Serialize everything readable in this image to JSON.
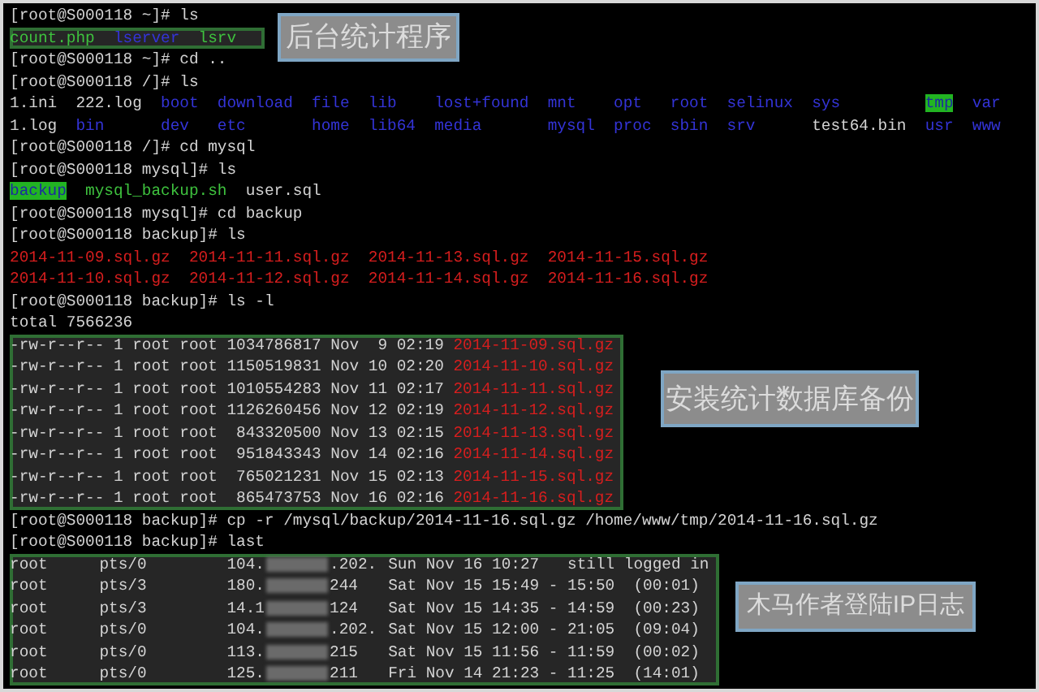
{
  "terminal": {
    "blocks": [
      {
        "kind": "prompt",
        "text": "[root@S000118 ~]# ls"
      },
      {
        "kind": "listing",
        "highlighted": true,
        "rows": [
          [
            {
              "name": "count.php",
              "kind": "exec"
            },
            {
              "name": "lserver",
              "kind": "dir"
            },
            {
              "name": "lsrv",
              "kind": "exec"
            }
          ]
        ]
      },
      {
        "kind": "prompt",
        "text": "[root@S000118 ~]# cd .."
      },
      {
        "kind": "prompt",
        "text": "[root@S000118 /]# ls"
      },
      {
        "kind": "listing",
        "highlighted": false,
        "rows": [
          [
            {
              "name": "1.ini",
              "kind": "file"
            },
            {
              "name": "222.log",
              "kind": "file"
            },
            {
              "name": "boot",
              "kind": "dir"
            },
            {
              "name": "download",
              "kind": "dir"
            },
            {
              "name": "file",
              "kind": "dir"
            },
            {
              "name": "lib",
              "kind": "dir"
            },
            {
              "name": "lost+found",
              "kind": "dir"
            },
            {
              "name": "mnt",
              "kind": "dir"
            },
            {
              "name": "opt",
              "kind": "dir"
            },
            {
              "name": "root",
              "kind": "dir"
            },
            {
              "name": "selinux",
              "kind": "dir"
            },
            {
              "name": "sys",
              "kind": "dir"
            },
            {
              "name": "tmp",
              "kind": "sticky_dir"
            },
            {
              "name": "var",
              "kind": "dir"
            }
          ],
          [
            {
              "name": "1.log",
              "kind": "file"
            },
            {
              "name": "bin",
              "kind": "dir"
            },
            {
              "name": "dev",
              "kind": "dir"
            },
            {
              "name": "etc",
              "kind": "dir"
            },
            {
              "name": "home",
              "kind": "dir"
            },
            {
              "name": "lib64",
              "kind": "dir"
            },
            {
              "name": "media",
              "kind": "dir"
            },
            {
              "name": "mysql",
              "kind": "dir"
            },
            {
              "name": "proc",
              "kind": "dir"
            },
            {
              "name": "sbin",
              "kind": "dir"
            },
            {
              "name": "srv",
              "kind": "dir"
            },
            {
              "name": "test64.bin",
              "kind": "file"
            },
            {
              "name": "usr",
              "kind": "dir"
            },
            {
              "name": "www",
              "kind": "dir"
            }
          ]
        ]
      },
      {
        "kind": "prompt",
        "text": "[root@S000118 /]# cd mysql"
      },
      {
        "kind": "prompt",
        "text": "[root@S000118 mysql]# ls"
      },
      {
        "kind": "listing",
        "highlighted": false,
        "rows": [
          [
            {
              "name": "backup",
              "kind": "sticky_dir"
            },
            {
              "name": "mysql_backup.sh",
              "kind": "exec"
            },
            {
              "name": "user.sql",
              "kind": "file"
            }
          ]
        ]
      },
      {
        "kind": "prompt",
        "text": "[root@S000118 mysql]# cd backup"
      },
      {
        "kind": "prompt",
        "text": "[root@S000118 backup]# ls"
      },
      {
        "kind": "listing",
        "highlighted": false,
        "rows": [
          [
            {
              "name": "2014-11-09.sql.gz",
              "kind": "archive"
            },
            {
              "name": "2014-11-11.sql.gz",
              "kind": "archive"
            },
            {
              "name": "2014-11-13.sql.gz",
              "kind": "archive"
            },
            {
              "name": "2014-11-15.sql.gz",
              "kind": "archive"
            }
          ],
          [
            {
              "name": "2014-11-10.sql.gz",
              "kind": "archive"
            },
            {
              "name": "2014-11-12.sql.gz",
              "kind": "archive"
            },
            {
              "name": "2014-11-14.sql.gz",
              "kind": "archive"
            },
            {
              "name": "2014-11-16.sql.gz",
              "kind": "archive"
            }
          ]
        ]
      },
      {
        "kind": "prompt",
        "text": "[root@S000118 backup]# ls -l"
      },
      {
        "kind": "prompt",
        "text": "total 7566236"
      },
      {
        "kind": "long_listing",
        "highlighted": true,
        "rows": [
          {
            "info": "-rw-r--r-- 1 root root 1034786817 Nov  9 02:19",
            "name": "2014-11-09.sql.gz"
          },
          {
            "info": "-rw-r--r-- 1 root root 1150519831 Nov 10 02:20",
            "name": "2014-11-10.sql.gz"
          },
          {
            "info": "-rw-r--r-- 1 root root 1010554283 Nov 11 02:17",
            "name": "2014-11-11.sql.gz"
          },
          {
            "info": "-rw-r--r-- 1 root root 1126260456 Nov 12 02:19",
            "name": "2014-11-12.sql.gz"
          },
          {
            "info": "-rw-r--r-- 1 root root  843320500 Nov 13 02:15",
            "name": "2014-11-13.sql.gz"
          },
          {
            "info": "-rw-r--r-- 1 root root  951843343 Nov 14 02:16",
            "name": "2014-11-14.sql.gz"
          },
          {
            "info": "-rw-r--r-- 1 root root  765021231 Nov 15 02:13",
            "name": "2014-11-15.sql.gz"
          },
          {
            "info": "-rw-r--r-- 1 root root  865473753 Nov 16 02:16",
            "name": "2014-11-16.sql.gz"
          }
        ]
      },
      {
        "kind": "prompt",
        "text": "[root@S000118 backup]# cp -r /mysql/backup/2014-11-16.sql.gz /home/www/tmp/2014-11-16.sql.gz"
      },
      {
        "kind": "prompt",
        "text": "[root@S000118 backup]# last"
      },
      {
        "kind": "logins",
        "highlighted": true,
        "rows": [
          {
            "user": "root",
            "tty": "pts/0",
            "ip_start": "104.",
            "ip_end": ".202.",
            "time": "Sun Nov 16 10:27   still logged in"
          },
          {
            "user": "root",
            "tty": "pts/3",
            "ip_start": "180.",
            "ip_end": "244",
            "time": "Sat Nov 15 15:49 - 15:50  (00:01)"
          },
          {
            "user": "root",
            "tty": "pts/3",
            "ip_start": "14.1",
            "ip_end": "124",
            "time": "Sat Nov 15 14:35 - 14:59  (00:23)"
          },
          {
            "user": "root",
            "tty": "pts/0",
            "ip_start": "104.",
            "ip_end": ".202.",
            "time": "Sat Nov 15 12:00 - 21:05  (09:04)"
          },
          {
            "user": "root",
            "tty": "pts/0",
            "ip_start": "113.",
            "ip_end": "215",
            "time": "Sat Nov 15 11:56 - 11:59  (00:02)"
          },
          {
            "user": "root",
            "tty": "pts/0",
            "ip_start": "125.",
            "ip_end": "211",
            "time": "Fri Nov 14 21:23 - 11:25  (14:01)"
          }
        ]
      }
    ]
  },
  "annotations": [
    {
      "text": "后台统计程序"
    },
    {
      "text": "安装统计数据库备份"
    },
    {
      "text": "木马作者登陆IP日志"
    }
  ]
}
